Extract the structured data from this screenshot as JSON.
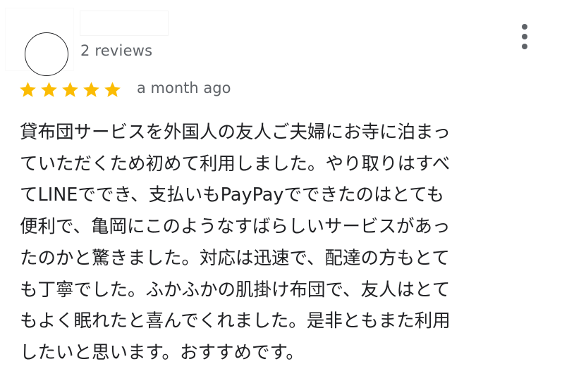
{
  "reviewer": {
    "reviews_count": "2 reviews",
    "avatar_icon": "user-avatar-circle"
  },
  "menu": {
    "icon": "more-vertical-icon"
  },
  "rating": {
    "stars": 5,
    "max": 5,
    "star_color": "#fbbc04"
  },
  "date": "a month ago",
  "review": {
    "lines": [
      "貸布団サービスを外国人の友人ご夫婦にお寺に泊まっ",
      "ていただくため初めて利用しました。やり取りはすべ",
      "てLINEででき、支払いもPayPayでできたのはとても",
      "便利で、亀岡にこのようなすばらしいサービスがあっ",
      "たのかと驚きました。対応は迅速で、配達の方もとて",
      "も丁寧でした。ふかふかの肌掛け布団で、友人はとて",
      "もよく眠れたと喜んでくれました。是非ともまた利用",
      "したいと思います。おすすめです。"
    ]
  }
}
